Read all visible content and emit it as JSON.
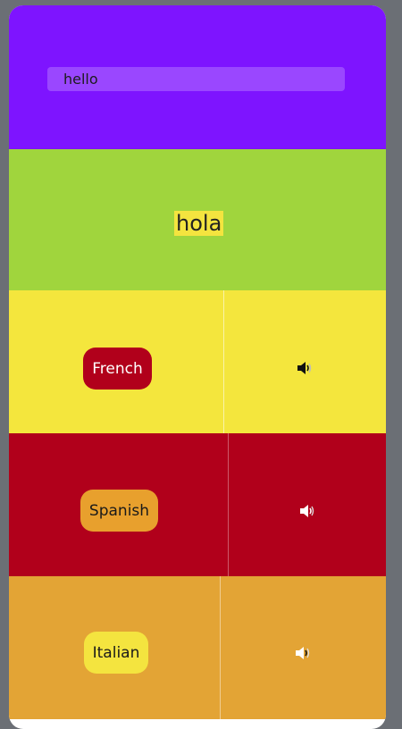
{
  "input": {
    "value": "hello"
  },
  "translation": {
    "text": "hola"
  },
  "languages": [
    {
      "label": "French"
    },
    {
      "label": "Spanish"
    },
    {
      "label": "Italian"
    }
  ],
  "colors": {
    "top": "#7e14ff",
    "translation_bg": "#a0d53d",
    "highlight": "#f4e43f",
    "french_row": "#f4e63d",
    "french_button": "#b1001b",
    "spanish_row": "#b1001b",
    "spanish_button": "#e8a02d",
    "italian_row": "#e3a435",
    "italian_button": "#f4e43f"
  },
  "icons": {
    "speaker": "speaker-icon"
  }
}
